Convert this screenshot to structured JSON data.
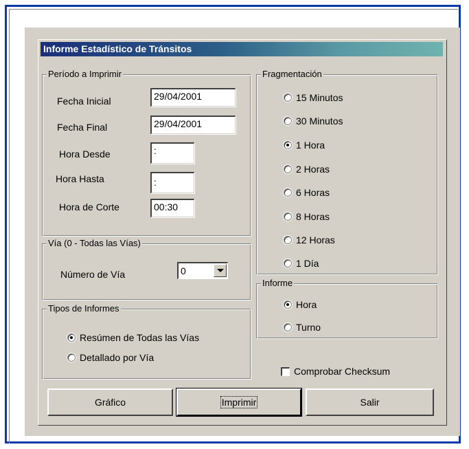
{
  "window": {
    "title": "Informe Estadístico de Tránsitos"
  },
  "periodo": {
    "legend": "Período a Imprimir",
    "fecha_inicial_label": "Fecha Inicial",
    "fecha_inicial_value": "29/04/2001",
    "fecha_final_label": "Fecha Final",
    "fecha_final_value": "29/04/2001",
    "hora_desde_label": "Hora Desde",
    "hora_desde_value": ":",
    "hora_hasta_label": "Hora Hasta",
    "hora_hasta_value": ":",
    "hora_corte_label": "Hora de Corte",
    "hora_corte_value": "00:30"
  },
  "via": {
    "legend": "Vía (0 - Todas las Vías)",
    "numero_label": "Número de Vía",
    "numero_value": "0"
  },
  "tipos": {
    "legend": "Tipos de Informes",
    "options": [
      {
        "label": "Resúmen de Todas las Vías",
        "checked": true
      },
      {
        "label": "Detallado por Vía",
        "checked": false
      }
    ]
  },
  "fragmentacion": {
    "legend": "Fragmentación",
    "options": [
      {
        "label": "15 Minutos",
        "checked": false
      },
      {
        "label": "30 Minutos",
        "checked": false
      },
      {
        "label": "1 Hora",
        "checked": true
      },
      {
        "label": "2 Horas",
        "checked": false
      },
      {
        "label": "6 Horas",
        "checked": false
      },
      {
        "label": "8 Horas",
        "checked": false
      },
      {
        "label": "12  Horas",
        "checked": false
      },
      {
        "label": "1 Día",
        "checked": false
      }
    ]
  },
  "informe": {
    "legend": "Informe",
    "options": [
      {
        "label": "Hora",
        "checked": true
      },
      {
        "label": "Turno",
        "checked": false
      }
    ]
  },
  "checksum": {
    "label": "Comprobar Checksum",
    "checked": false
  },
  "buttons": {
    "grafico": "Gráfico",
    "imprimir": "Imprimir",
    "salir": "Salir"
  }
}
